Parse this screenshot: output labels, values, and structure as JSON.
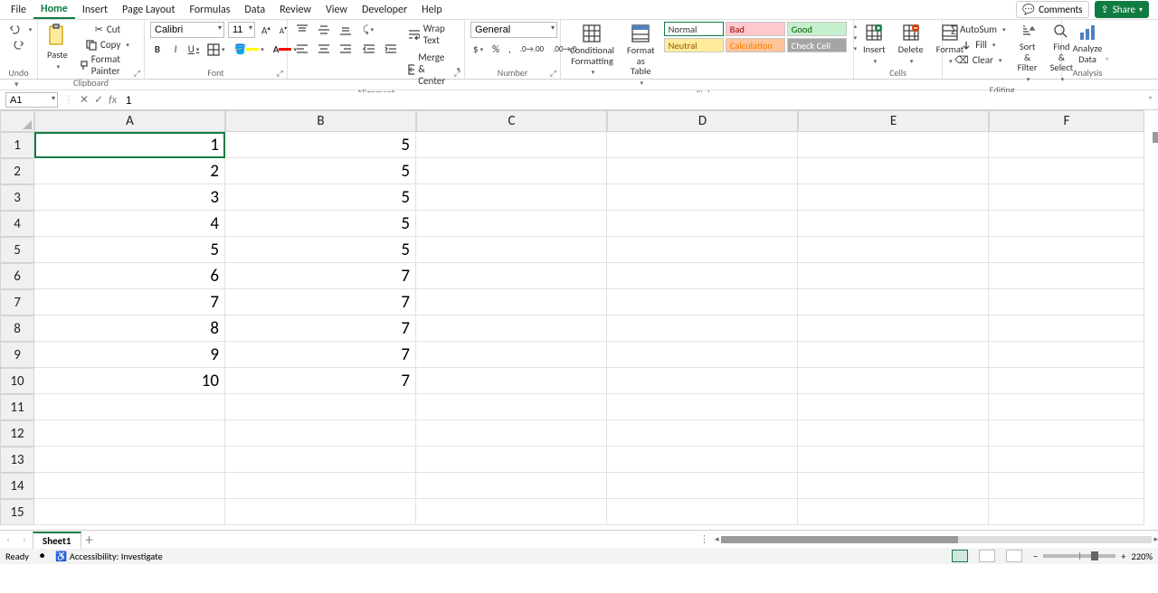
{
  "menu": {
    "file": "File",
    "home": "Home",
    "insert": "Insert",
    "page_layout": "Page Layout",
    "formulas": "Formulas",
    "data": "Data",
    "review": "Review",
    "view": "View",
    "developer": "Developer",
    "help": "Help"
  },
  "topright": {
    "comments": "Comments",
    "share": "Share"
  },
  "groups": {
    "undo": "Undo",
    "clipboard": "Clipboard",
    "font": "Font",
    "alignment": "Alignment",
    "number": "Number",
    "styles": "Styles",
    "cells": "Cells",
    "editing": "Editing",
    "analysis": "Analysis"
  },
  "clipboard": {
    "paste": "Paste",
    "cut": "Cut",
    "copy": "Copy",
    "format_painter": "Format Painter"
  },
  "font": {
    "name": "Calibri",
    "size": "11",
    "bold": "B",
    "italic": "I",
    "underline": "U",
    "grow": "A",
    "shrink": "A"
  },
  "alignment": {
    "wrap": "Wrap Text",
    "merge": "Merge & Center"
  },
  "number": {
    "format": "General"
  },
  "styles": {
    "cond": "Conditional Formatting",
    "table": "Format as Table",
    "normal": "Normal",
    "bad": "Bad",
    "good": "Good",
    "neutral": "Neutral",
    "calc": "Calculation",
    "check": "Check Cell"
  },
  "cells": {
    "insert": "Insert",
    "delete": "Delete",
    "format": "Format"
  },
  "editing": {
    "sum": "AutoSum",
    "fill": "Fill",
    "clear": "Clear",
    "sort": "Sort & Filter",
    "find": "Find & Select"
  },
  "analysis": {
    "analyze": "Analyze Data"
  },
  "formula_bar": {
    "namebox": "A1",
    "fx": "fx",
    "value": "1"
  },
  "columns": [
    "A",
    "B",
    "C",
    "D",
    "E",
    "F"
  ],
  "rows": [
    "1",
    "2",
    "3",
    "4",
    "5",
    "6",
    "7",
    "8",
    "9",
    "10",
    "11",
    "12",
    "13",
    "14",
    "15"
  ],
  "data_a": [
    "1",
    "2",
    "3",
    "4",
    "5",
    "6",
    "7",
    "8",
    "9",
    "10"
  ],
  "data_b": [
    "5",
    "5",
    "5",
    "5",
    "5",
    "7",
    "7",
    "7",
    "7",
    "7"
  ],
  "sheet": {
    "name": "Sheet1"
  },
  "status": {
    "ready": "Ready",
    "accessibility": "Accessibility: Investigate",
    "zoom": "220%"
  }
}
